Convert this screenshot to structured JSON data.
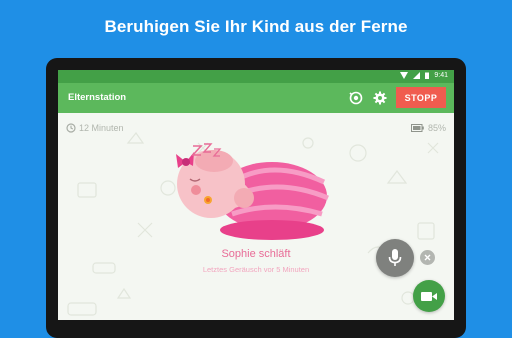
{
  "headline": "Beruhigen Sie Ihr Kind aus der Ferne",
  "status_bar": {
    "time": "9:41",
    "icons": [
      "wifi-icon",
      "signal-icon",
      "battery-icon"
    ]
  },
  "app_bar": {
    "title": "Elternstation",
    "icons": [
      "noise-monitor-icon",
      "settings-gear-icon"
    ],
    "stop_button": "STOPP"
  },
  "session": {
    "elapsed": "12 Minuten",
    "battery": "85%"
  },
  "baby_status": {
    "title": "Sophie schläft",
    "last_noise": "Letztes Geräusch vor 5 Minuten"
  },
  "controls": [
    "microphone-icon",
    "close-icon",
    "video-camera-icon"
  ],
  "colors": {
    "background": "#1f8fe6",
    "status_bar": "#43a047",
    "app_bar": "#5cb85c",
    "stop_button": "#f05c4f",
    "accent_pink": "#e86c97",
    "mic_button": "#7f817e",
    "video_button": "#43a047"
  }
}
